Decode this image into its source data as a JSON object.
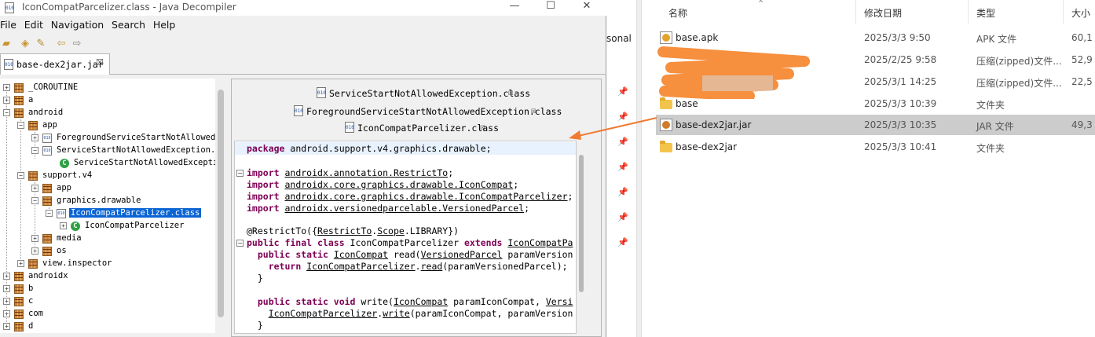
{
  "jd_window": {
    "title": "IconCompatParcelizer.class - Java Decompiler",
    "controls": {
      "minimize": "—",
      "maximize": "☐",
      "close": "✕"
    },
    "menu": [
      "File",
      "Edit",
      "Navigation",
      "Search",
      "Help"
    ],
    "jar_tab": {
      "label": "base-dex2jar.jar",
      "close": "☒"
    },
    "tree": [
      {
        "label": "_COROUTINE"
      },
      {
        "label": "a"
      },
      {
        "label": "android"
      },
      {
        "label": "app"
      },
      {
        "label": "ForegroundServiceStartNotAllowed"
      },
      {
        "label": "ServiceStartNotAllowedException."
      },
      {
        "label": "ServiceStartNotAllowedExcepti"
      },
      {
        "label": "support.v4"
      },
      {
        "label": "app"
      },
      {
        "label": "graphics.drawable"
      },
      {
        "label": "IconCompatParcelizer.class"
      },
      {
        "label": "IconCompatParcelizer"
      },
      {
        "label": "media"
      },
      {
        "label": "os"
      },
      {
        "label": "view.inspector"
      },
      {
        "label": "androidx"
      },
      {
        "label": "b"
      },
      {
        "label": "c"
      },
      {
        "label": "com"
      },
      {
        "label": "d"
      }
    ],
    "editor_tabs": [
      {
        "label": "ServiceStartNotAllowedException.class"
      },
      {
        "label": "ForegroundServiceStartNotAllowedException.class"
      },
      {
        "label": "IconCompatParcelizer.class"
      }
    ],
    "code": {
      "l1a": "package",
      "l1b": " android.support.v4.graphics.drawable;",
      "imp": "import",
      "i1": "androidx.annotation.RestrictTo",
      "i2": "androidx.core.graphics.drawable.IconCompat",
      "i3": "androidx.core.graphics.drawable.IconCompatParcelizer",
      "i4": "androidx.versionedparcelable.VersionedParcel",
      "ann1": "@RestrictTo({",
      "ann2": "RestrictTo",
      "ann3": "Scope",
      "ann4": ".LIBRARY})",
      "cls_kw": "public final class",
      "cls_name": " IconCompatParcelizer ",
      "ext": "extends",
      "ext_name": "IconCompatPa",
      "m1_kw": "public static",
      "m1_type": "IconCompat",
      "m1_name": " read(",
      "m1_param": "VersionedParcel",
      "m1_rest": " paramVersion",
      "ret": "return",
      "ret_cls": "IconCompatParcelizer",
      "ret_m": "read",
      "ret_rest": "(paramVersionedParcel);",
      "brace": "}",
      "m2_kw": "public static void",
      "m2_name": " write(",
      "m2_type": "IconCompat",
      "m2_rest": " paramIconCompat, ",
      "m2_more": "Versi",
      "c2_cls": "IconCompatParcelizer",
      "c2_m": "write",
      "c2_rest": "(paramIconCompat, paramVersion",
      "semi": ";",
      "dot": "."
    }
  },
  "explorer": {
    "side_text": "sonal",
    "columns": {
      "name": "名称",
      "date": "修改日期",
      "type": "类型",
      "size": "大小"
    },
    "files": [
      {
        "name": "base.apk",
        "date": "2025/3/3 9:50",
        "type": "APK 文件",
        "size": "60,1"
      },
      {
        "name": "",
        "date": "2025/2/25 9:58",
        "type": "压缩(zipped)文件...",
        "size": "52,9"
      },
      {
        "name": "",
        "date": "2025/3/1 14:25",
        "type": "压缩(zipped)文件...",
        "size": "22,5"
      },
      {
        "name": "base",
        "date": "2025/3/3 10:39",
        "type": "文件夹",
        "size": ""
      },
      {
        "name": "base-dex2jar.jar",
        "date": "2025/3/3 10:35",
        "type": "JAR 文件",
        "size": "49,3"
      },
      {
        "name": "base-dex2jar",
        "date": "2025/3/3 10:41",
        "type": "文件夹",
        "size": ""
      }
    ]
  },
  "colors": {
    "selection_blue": "#0a64d2",
    "keyword": "#7f0055",
    "arrow": "#f07a32",
    "redaction": "#f5852e"
  }
}
